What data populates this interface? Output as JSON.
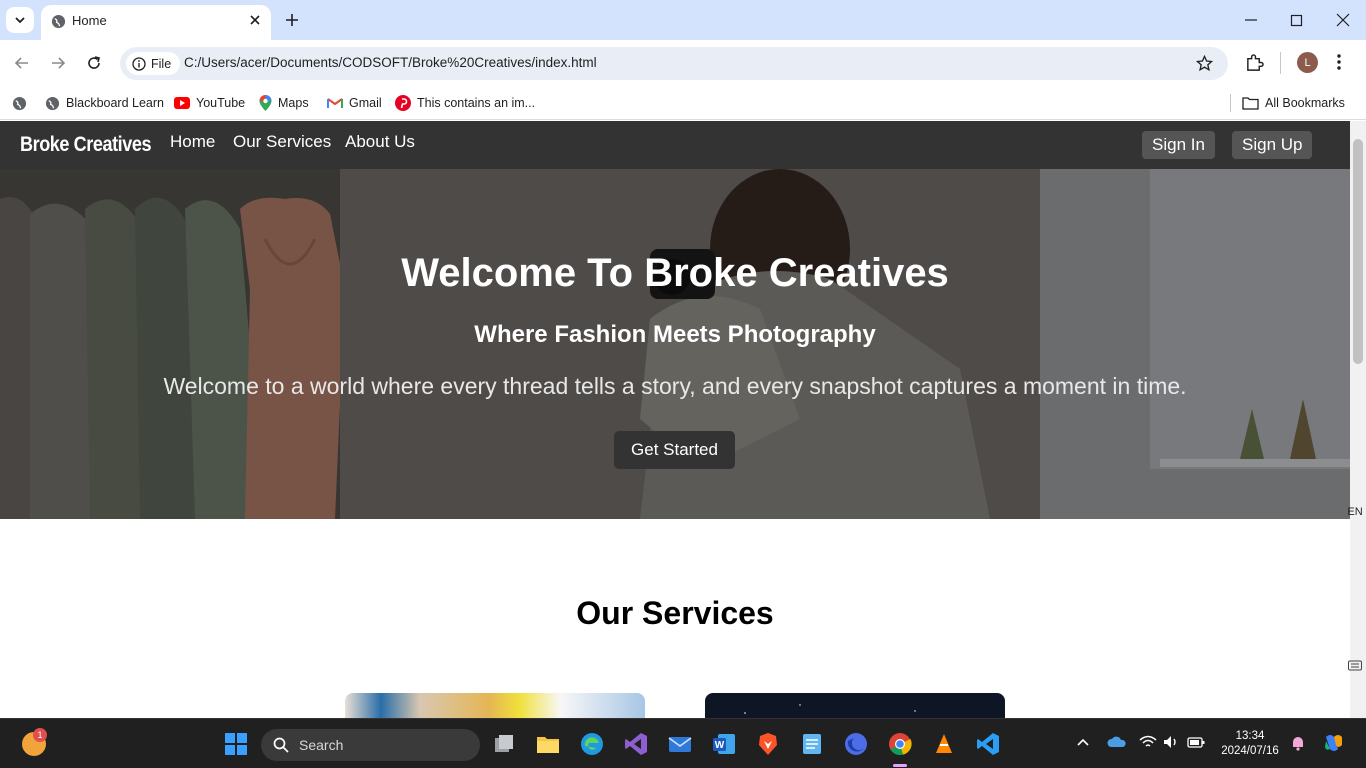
{
  "browser": {
    "tab_title": "Home",
    "site_chip_label": "File",
    "url": "C:/Users/acer/Documents/CODSOFT/Broke%20Creatives/index.html",
    "profile_initial": "L",
    "bookmarks": [
      {
        "label": "Blackboard Learn",
        "icon": "globe-icon"
      },
      {
        "label": "YouTube",
        "icon": "youtube-icon"
      },
      {
        "label": "Maps",
        "icon": "maps-icon"
      },
      {
        "label": "Gmail",
        "icon": "gmail-icon"
      },
      {
        "label": "This contains an im...",
        "icon": "pinterest-icon"
      }
    ],
    "all_bookmarks_label": "All Bookmarks"
  },
  "site": {
    "brand": "Broke Creatives",
    "nav": [
      "Home",
      "Our Services",
      "About Us"
    ],
    "sign_in": "Sign In",
    "sign_up": "Sign Up",
    "hero": {
      "title": "Welcome To Broke Creatives",
      "subtitle": "Where Fashion Meets Photography",
      "text": "Welcome to a world where every thread tells a story, and every snapshot captures a moment in time.",
      "cta": "Get Started"
    },
    "services_title": "Our Services"
  },
  "side_widget": {
    "language": "EN"
  },
  "taskbar": {
    "search_placeholder": "Search",
    "weather_badge": "1",
    "time": "13:34",
    "date": "2024/07/16"
  },
  "colors": {
    "nav_bg": "#333333",
    "button_bg": "#555555",
    "chrome_tabstrip": "#d3e3fd",
    "taskbar_bg": "#202020"
  }
}
